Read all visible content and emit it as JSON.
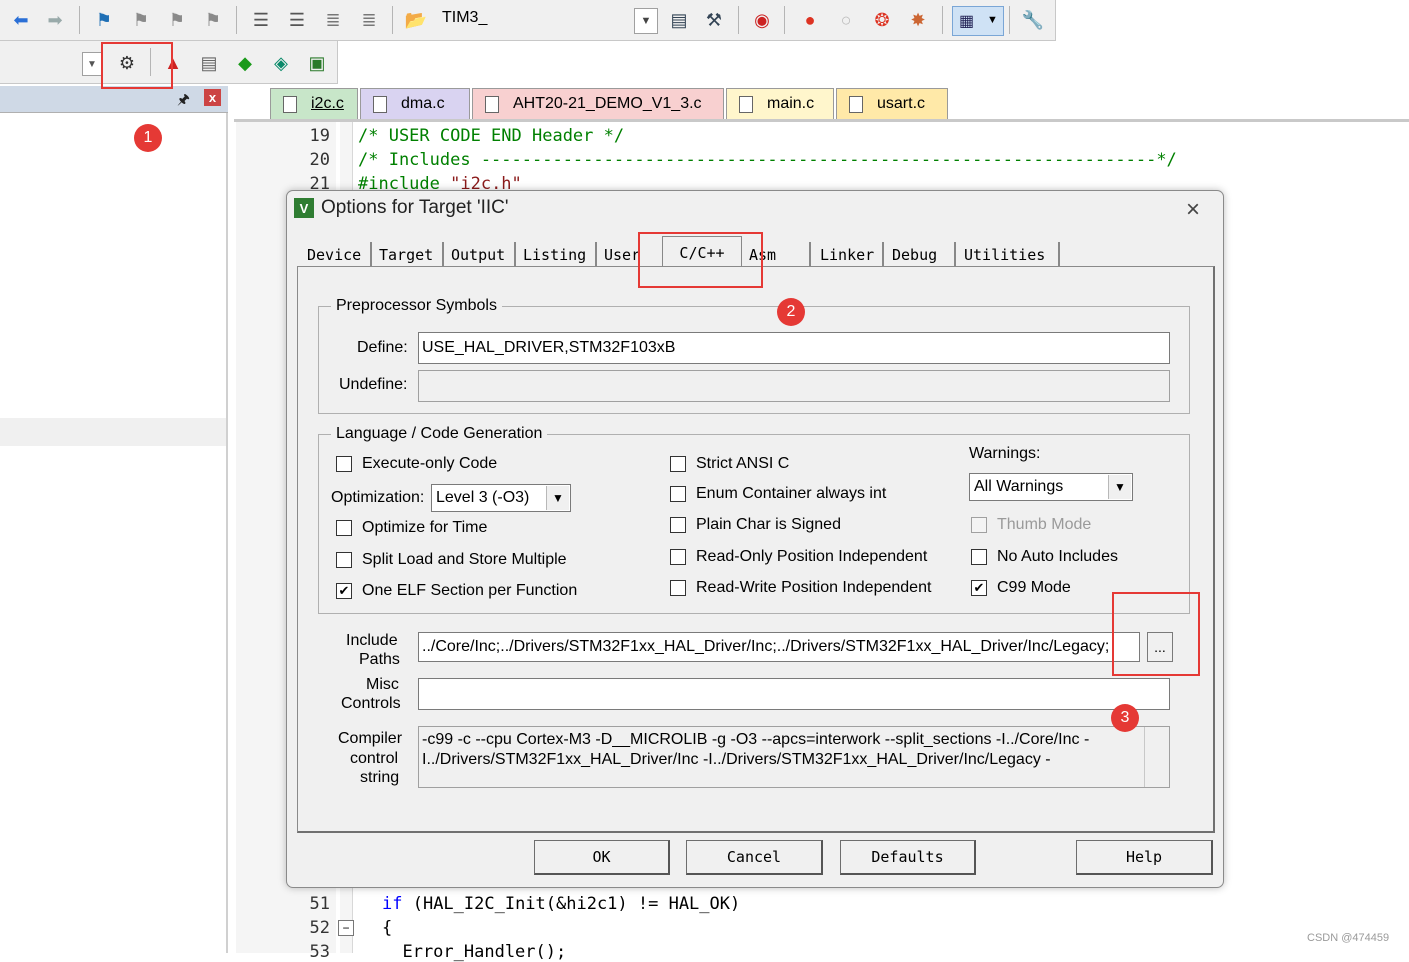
{
  "toolbar": {
    "target_name": "TIM3_",
    "icons_row1": [
      "back-icon",
      "forward-icon",
      "bookmark-flag-icon",
      "bookmark-prev-icon",
      "bookmark-next-icon",
      "bookmark-clear-icon",
      "indent-icon",
      "outdent-icon",
      "comment-icon",
      "uncomment-icon",
      "open-file-icon",
      "target-select-icon",
      "find-in-files-icon",
      "debug-settings-icon",
      "start-debug-icon",
      "breakpoint-icon",
      "breakpoint-disable-icon",
      "breakpoint-kill-icon",
      "breakpoint-all-icon",
      "window-layout-icon",
      "configure-icon"
    ],
    "icons_row2": [
      "dropdown-icon",
      "options-for-target-icon",
      "manage-components-icon",
      "manage-project-items-icon",
      "pack-installer-icon",
      "select-packs-icon",
      "batch-build-icon"
    ]
  },
  "left_panel": {
    "pin_icon": "pin-icon",
    "close_label": "x"
  },
  "editor": {
    "tabs": [
      {
        "label": "i2c.c",
        "color": "#c8e6c9",
        "active": true
      },
      {
        "label": "dma.c",
        "color": "#d9d3f1"
      },
      {
        "label": "AHT20-21_DEMO_V1_3.c",
        "color": "#f8d0d0"
      },
      {
        "label": "main.c",
        "color": "#fff6cc"
      },
      {
        "label": "usart.c",
        "color": "#ffe9a8"
      }
    ],
    "lines_top": [
      {
        "num": "19",
        "text": "/* USER CODE END Header */"
      },
      {
        "num": "20",
        "text": "/* Includes ------------------------------------------------------------------*/"
      },
      {
        "num": "21",
        "text_pre": "#include ",
        "text_str": "\"i2c.h\""
      }
    ],
    "lines_bottom": [
      {
        "num": "51",
        "kw": "if",
        "text": " (HAL_I2C_Init(&hi2c1) != HAL_OK)"
      },
      {
        "num": "52",
        "text": "{"
      },
      {
        "num": "53",
        "text": "  Error_Handler();"
      }
    ]
  },
  "dialog": {
    "title": "Options for Target 'IIC'",
    "close_label": "×",
    "tabs": [
      "Device",
      "Target",
      "Output",
      "Listing",
      "User",
      "C/C++",
      "Asm",
      "Linker",
      "Debug",
      "Utilities"
    ],
    "active_tab": "C/C++",
    "preprocessor": {
      "group_label": "Preprocessor Symbols",
      "define_label": "Define:",
      "define_value": "USE_HAL_DRIVER,STM32F103xB",
      "undefine_label": "Undefine:",
      "undefine_value": ""
    },
    "language": {
      "group_label": "Language / Code Generation",
      "execute_only": {
        "label": "Execute-only Code",
        "checked": false
      },
      "optimization_label": "Optimization:",
      "optimization_value": "Level 3 (-O3)",
      "optimize_time": {
        "label": "Optimize for Time",
        "checked": false
      },
      "split_load": {
        "label": "Split Load and Store Multiple",
        "checked": false
      },
      "one_elf": {
        "label": "One ELF Section per Function",
        "checked": true
      },
      "strict_ansi": {
        "label": "Strict ANSI C",
        "checked": false
      },
      "enum_container": {
        "label": "Enum Container always int",
        "checked": false
      },
      "plain_char": {
        "label": "Plain Char is Signed",
        "checked": false
      },
      "ropi": {
        "label": "Read-Only Position Independent",
        "checked": false
      },
      "rwpi": {
        "label": "Read-Write Position Independent",
        "checked": false
      },
      "warnings_label": "Warnings:",
      "warnings_value": "All Warnings",
      "thumb_mode": {
        "label": "Thumb Mode",
        "checked": false,
        "disabled": true
      },
      "no_auto_includes": {
        "label": "No Auto Includes",
        "checked": false
      },
      "c99_mode": {
        "label": "C99 Mode",
        "checked": true
      }
    },
    "include_paths_label_1": "Include",
    "include_paths_label_2": "Paths",
    "include_paths_value": "../Core/Inc;../Drivers/STM32F1xx_HAL_Driver/Inc;../Drivers/STM32F1xx_HAL_Driver/Inc/Legacy;",
    "browse_label": "...",
    "misc_label_1": "Misc",
    "misc_label_2": "Controls",
    "misc_value": "",
    "compiler_label_1": "Compiler",
    "compiler_label_2": "control",
    "compiler_label_3": "string",
    "compiler_line_1": "-c99 -c --cpu Cortex-M3 -D__MICROLIB -g -O3 --apcs=interwork --split_sections -I../Core/Inc -",
    "compiler_line_2": "I../Drivers/STM32F1xx_HAL_Driver/Inc -I../Drivers/STM32F1xx_HAL_Driver/Inc/Legacy -",
    "buttons": {
      "ok": "OK",
      "cancel": "Cancel",
      "defaults": "Defaults",
      "help": "Help"
    }
  },
  "annotations": {
    "badge_1": "1",
    "badge_2": "2",
    "badge_3": "3",
    "color": "#e53935"
  },
  "watermark": "CSDN @474459"
}
